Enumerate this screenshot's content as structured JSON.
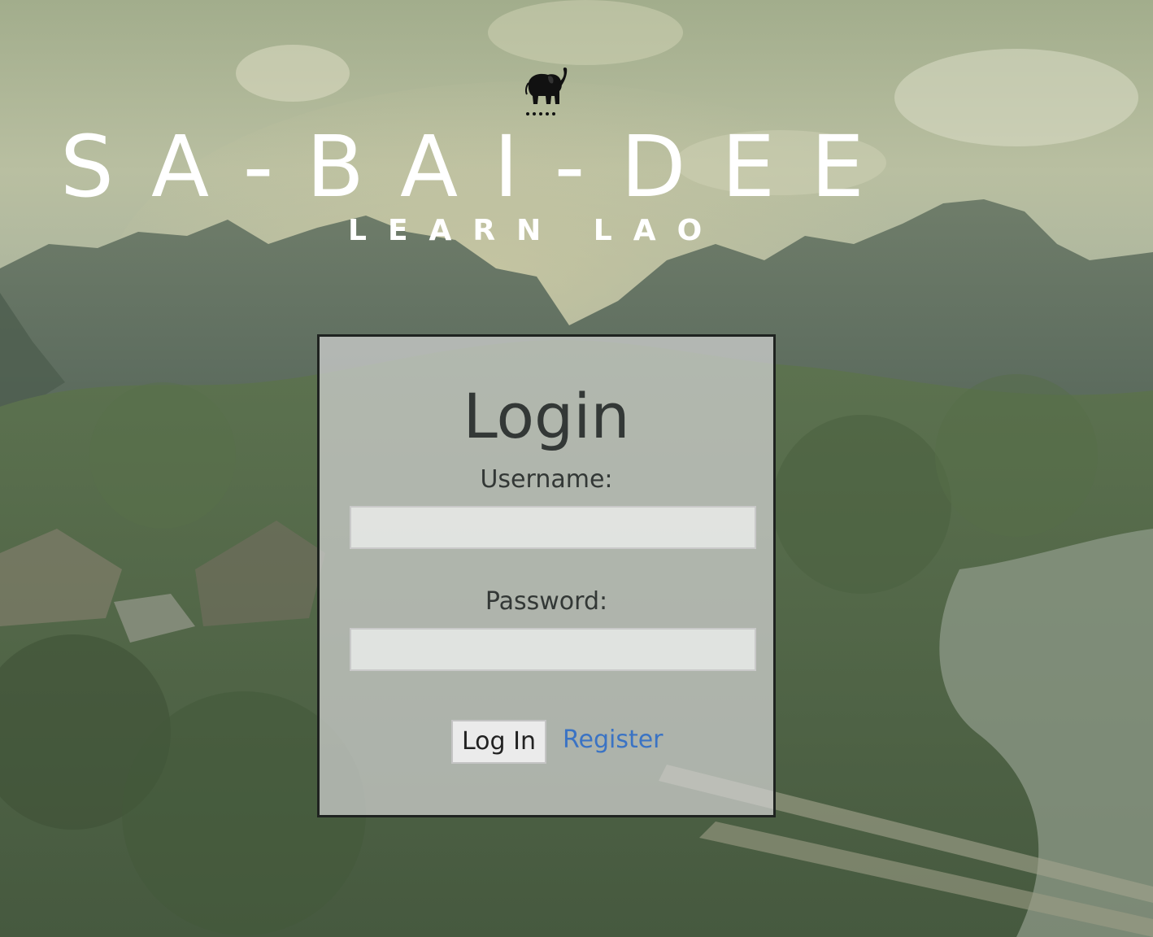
{
  "header": {
    "logo_icon": "elephant-icon",
    "title": "SA-BAI-DEE",
    "subtitle": "LEARN LAO"
  },
  "login": {
    "heading": "Login",
    "username_label": "Username:",
    "username_value": "",
    "password_label": "Password:",
    "password_value": "",
    "login_button": "Log In",
    "register_link": "Register"
  },
  "colors": {
    "title_text": "#ffffff",
    "panel_border": "#1f2320",
    "link": "#3a73c4"
  }
}
